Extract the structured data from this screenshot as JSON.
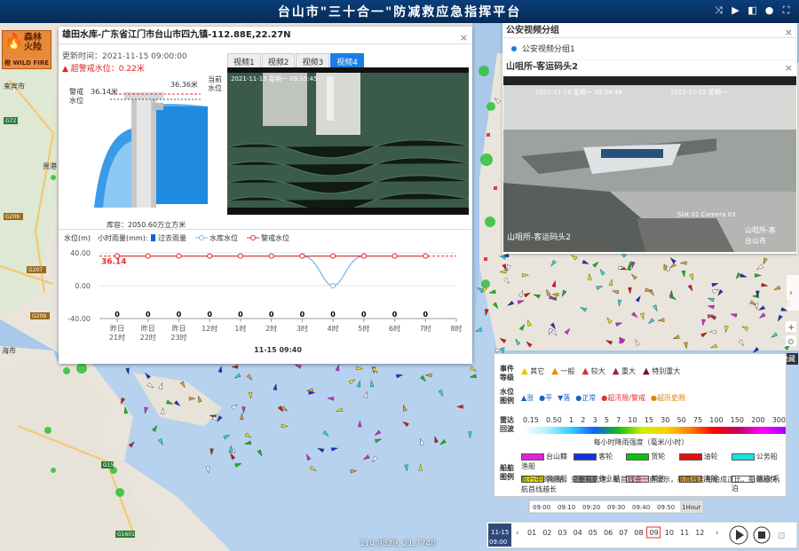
{
  "app": {
    "title": "台山市\"三十合一\"防减救应急指挥平台"
  },
  "fire_badge": {
    "line1": "森林",
    "line2": "火险",
    "level": "橙",
    "en": "WILD FIRE"
  },
  "map_labels": [
    "来宾市",
    "G72",
    "G209",
    "G15",
    "贵港",
    "G207",
    "G209",
    "G209",
    "G15",
    "G1601",
    "海市"
  ],
  "reservoir": {
    "title": "雄田水库-广东省江门市台山市四九镇-112.88E,22.27N",
    "updated": "更新时间：2021-11-15 09:00:00",
    "warning": "超警戒水位：0.22米",
    "warn_label_a": "警戒",
    "warn_label_b": "水位",
    "warn_value": "36.14米",
    "cur_label_a": "当前",
    "cur_label_b": "水位",
    "cur_value": "36.36米",
    "capacity": "库容：2050.60万立方米",
    "tabs": [
      "视频1",
      "视频2",
      "视频3",
      "视频4"
    ],
    "active_tab": 3
  },
  "chart_data": {
    "type": "line",
    "ylabel_left": "水位(m)",
    "ylabel_right": "小时雨量(mm):",
    "legend": [
      "过去雨量",
      "水库水位",
      "警戒水位"
    ],
    "y_ticks": [
      "40.00",
      "0.00",
      "-40.00"
    ],
    "ylim": [
      -40,
      40
    ],
    "warn_level": 36.14,
    "warn_label": "36.14",
    "categories": [
      "昨日21时",
      "昨日22时",
      "昨日23时",
      "12时",
      "1时",
      "2时",
      "3时",
      "4时",
      "5时",
      "6时",
      "7时",
      "8时"
    ],
    "cat_line1": [
      "昨日",
      "昨日",
      "昨日",
      "12时",
      "1时",
      "2时",
      "3时",
      "4时",
      "5时",
      "6时",
      "7时",
      "8时"
    ],
    "cat_line2": [
      "21时",
      "22时",
      "23时",
      "",
      "",
      "",
      "",
      "",
      "",
      "",
      "",
      ""
    ],
    "rain": [
      0,
      0,
      0,
      0,
      0,
      0,
      0,
      0,
      0,
      0,
      0,
      ""
    ],
    "reservoir_level": [
      null,
      null,
      null,
      null,
      null,
      null,
      36.3,
      0,
      36.3,
      null,
      null,
      null
    ],
    "warning_points": [
      36.14,
      36.14,
      36.14,
      36.14,
      36.14,
      36.14,
      36.14,
      36.14,
      36.14,
      36.14,
      36.14,
      null
    ],
    "xlabel": "11-15 09:40",
    "colors": {
      "rain": "#1a5fcf",
      "reservoir": "#7fb8e8",
      "warning": "#e03030"
    }
  },
  "police_panel": {
    "title": "公安视频分组",
    "item": "公安视频分组1"
  },
  "cam_panel": {
    "title": "山咀所-客运码头2",
    "ts_left": "2021-11-15 星期一 09:34:48",
    "ts_right": "2021-11-15 星期一",
    "slot": "Slot 01 Camera 03",
    "caption": "山咀所-客运码头2",
    "caption_r1": "山咀所-客",
    "caption_r2": "台山市"
  },
  "video_ts": "2021-11-15 星期一 09:35:45",
  "legend": {
    "event_label": "事件等级",
    "events": [
      "其它",
      "一般",
      "较大",
      "重大",
      "特别重大"
    ],
    "event_colors": [
      "#f2c200",
      "#f08a00",
      "#e03030",
      "#a0204a",
      "#7a1020"
    ],
    "water_label": "水位图例",
    "water": [
      "▲涨",
      "●平",
      "▼落",
      "●正常",
      "●超汛限/警戒",
      "●超历史限"
    ],
    "radar_label": "雷达回波",
    "radar_ticks": [
      "0.15",
      "0.50",
      "1",
      "2",
      "3",
      "5",
      "7",
      "10",
      "15",
      "30",
      "50",
      "75",
      "100",
      "150",
      "200",
      "300"
    ],
    "radar_caption": "每小时降雨强度（毫米/小时）",
    "ship_label": "船舶图例",
    "ships": [
      "台山籍渔船",
      "客轮",
      "货轮",
      "油轮",
      "公务船",
      "高速船",
      "作业船",
      "其他",
      "渔船",
      "锚泊/系泊"
    ],
    "ship_colors": [
      "#e020e0",
      "#1030e0",
      "#10c010",
      "#e01010",
      "#20e0e0",
      "#f0e000",
      "#909090",
      "#ffb6c1",
      "#e0a030",
      "#ffffff"
    ],
    "ship_note": "航行中的船舶，只要有航速，航首线会一直显示，航首线与船舶成正比，船速越快，航首线越长",
    "hide": "隐藏"
  },
  "timeline": {
    "ticks": [
      "09:00",
      "09:10",
      "09:20",
      "09:30",
      "09:40",
      "09:50",
      "1Hour"
    ],
    "date": "11-15",
    "time": "09:00",
    "hours": [
      "01",
      "02",
      "03",
      "04",
      "05",
      "06",
      "07",
      "08",
      "09",
      "10",
      "11",
      "12"
    ],
    "active": "09"
  },
  "coord": "114.9829, 21.7748"
}
